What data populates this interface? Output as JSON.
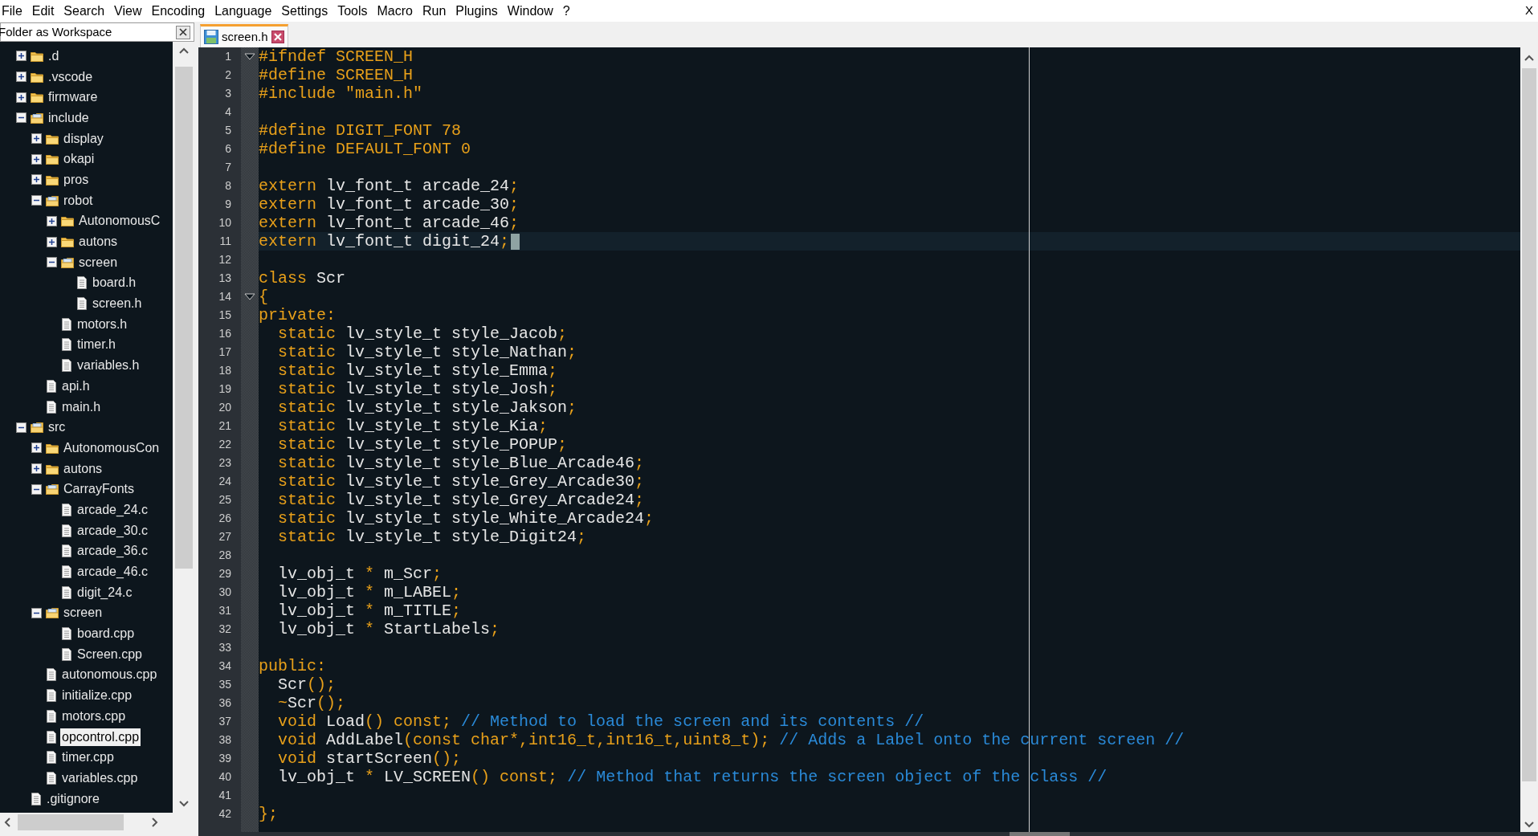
{
  "menu_bar": {
    "items": [
      "File",
      "Edit",
      "Search",
      "View",
      "Encoding",
      "Language",
      "Settings",
      "Tools",
      "Macro",
      "Run",
      "Plugins",
      "Window",
      "?"
    ],
    "close": "X"
  },
  "workspace_panel": {
    "title": "Folder as Workspace",
    "tree": [
      {
        "label": ".d",
        "kind": "folder",
        "expanded": false,
        "selected": false
      },
      {
        "label": ".vscode",
        "kind": "folder",
        "expanded": false,
        "selected": false
      },
      {
        "label": "firmware",
        "kind": "folder",
        "expanded": false,
        "selected": false
      },
      {
        "label": "include",
        "kind": "folder",
        "expanded": true,
        "selected": false,
        "children": [
          {
            "label": "display",
            "kind": "folder",
            "expanded": false,
            "selected": false
          },
          {
            "label": "okapi",
            "kind": "folder",
            "expanded": false,
            "selected": false
          },
          {
            "label": "pros",
            "kind": "folder",
            "expanded": false,
            "selected": false
          },
          {
            "label": "robot",
            "kind": "folder",
            "expanded": true,
            "selected": false,
            "children": [
              {
                "label": "AutonomousC",
                "kind": "folder",
                "expanded": false,
                "selected": false
              },
              {
                "label": "autons",
                "kind": "folder",
                "expanded": false,
                "selected": false
              },
              {
                "label": "screen",
                "kind": "folder",
                "expanded": true,
                "selected": false,
                "children": [
                  {
                    "label": "board.h",
                    "kind": "file",
                    "selected": false
                  },
                  {
                    "label": "screen.h",
                    "kind": "file",
                    "selected": false
                  }
                ]
              },
              {
                "label": "motors.h",
                "kind": "file",
                "selected": false
              },
              {
                "label": "timer.h",
                "kind": "file",
                "selected": false
              },
              {
                "label": "variables.h",
                "kind": "file",
                "selected": false
              }
            ]
          },
          {
            "label": "api.h",
            "kind": "file",
            "selected": false
          },
          {
            "label": "main.h",
            "kind": "file",
            "selected": false
          }
        ]
      },
      {
        "label": "src",
        "kind": "folder",
        "expanded": true,
        "selected": false,
        "children": [
          {
            "label": "AutonomousCon",
            "kind": "folder",
            "expanded": false,
            "selected": false
          },
          {
            "label": "autons",
            "kind": "folder",
            "expanded": false,
            "selected": false
          },
          {
            "label": "CarrayFonts",
            "kind": "folder",
            "expanded": true,
            "selected": false,
            "children": [
              {
                "label": "arcade_24.c",
                "kind": "file",
                "selected": false
              },
              {
                "label": "arcade_30.c",
                "kind": "file",
                "selected": false
              },
              {
                "label": "arcade_36.c",
                "kind": "file",
                "selected": false
              },
              {
                "label": "arcade_46.c",
                "kind": "file",
                "selected": false
              },
              {
                "label": "digit_24.c",
                "kind": "file",
                "selected": false
              }
            ]
          },
          {
            "label": "screen",
            "kind": "folder",
            "expanded": true,
            "selected": false,
            "children": [
              {
                "label": "board.cpp",
                "kind": "file",
                "selected": false
              },
              {
                "label": "Screen.cpp",
                "kind": "file",
                "selected": false
              }
            ]
          },
          {
            "label": "autonomous.cpp",
            "kind": "file",
            "selected": false
          },
          {
            "label": "initialize.cpp",
            "kind": "file",
            "selected": false
          },
          {
            "label": "motors.cpp",
            "kind": "file",
            "selected": false
          },
          {
            "label": "opcontrol.cpp",
            "kind": "file",
            "selected": true
          },
          {
            "label": "timer.cpp",
            "kind": "file",
            "selected": false
          },
          {
            "label": "variables.cpp",
            "kind": "file",
            "selected": false
          }
        ]
      },
      {
        "label": ".gitignore",
        "kind": "file",
        "selected": false
      }
    ]
  },
  "tabs": [
    {
      "label": "screen.h",
      "selected": true
    }
  ],
  "editor": {
    "lines": [
      {
        "number": "1",
        "fold": true,
        "tokens": [
          {
            "kind": "preprocessor",
            "text": "#ifndef SCREEN_H"
          }
        ]
      },
      {
        "number": "2",
        "tokens": [
          {
            "kind": "preprocessor",
            "text": "#define SCREEN_H"
          }
        ]
      },
      {
        "number": "3",
        "tokens": [
          {
            "kind": "preprocessor",
            "text": "#include \"main.h\""
          }
        ]
      },
      {
        "number": "4"
      },
      {
        "number": "5",
        "tokens": [
          {
            "kind": "preprocessor",
            "text": "#define DIGIT_FONT 78"
          }
        ]
      },
      {
        "number": "6",
        "tokens": [
          {
            "kind": "preprocessor",
            "text": "#define DEFAULT_FONT 0"
          }
        ]
      },
      {
        "number": "7"
      },
      {
        "number": "8",
        "tokens": [
          {
            "kind": "keyword",
            "text": "extern"
          },
          {
            "kind": "plain",
            "text": " lv_font_t arcade_24"
          },
          {
            "kind": "operator",
            "text": ";"
          }
        ]
      },
      {
        "number": "9",
        "tokens": [
          {
            "kind": "keyword",
            "text": "extern"
          },
          {
            "kind": "plain",
            "text": " lv_font_t arcade_30"
          },
          {
            "kind": "operator",
            "text": ";"
          }
        ]
      },
      {
        "number": "10",
        "tokens": [
          {
            "kind": "keyword",
            "text": "extern"
          },
          {
            "kind": "plain",
            "text": " lv_font_t arcade_46"
          },
          {
            "kind": "operator",
            "text": ";"
          }
        ]
      },
      {
        "number": "11",
        "current": true,
        "tokens": [
          {
            "kind": "keyword",
            "text": "extern"
          },
          {
            "kind": "plain",
            "text": " lv_font_t digit_24"
          },
          {
            "kind": "operator",
            "text": ";"
          }
        ]
      },
      {
        "number": "12"
      },
      {
        "number": "13",
        "tokens": [
          {
            "kind": "keyword",
            "text": "class"
          },
          {
            "kind": "plain",
            "text": " Scr"
          }
        ]
      },
      {
        "number": "14",
        "fold": true,
        "tokens": [
          {
            "kind": "operator",
            "text": "{"
          }
        ]
      },
      {
        "number": "15",
        "tokens": [
          {
            "kind": "keyword",
            "text": "private:"
          }
        ]
      },
      {
        "number": "16",
        "indented": true,
        "tokens": [
          {
            "kind": "keyword",
            "text": "static"
          },
          {
            "kind": "plain",
            "text": " lv_style_t style_Jacob"
          },
          {
            "kind": "operator",
            "text": ";"
          }
        ]
      },
      {
        "number": "17",
        "indented": true,
        "tokens": [
          {
            "kind": "keyword",
            "text": "static"
          },
          {
            "kind": "plain",
            "text": " lv_style_t style_Nathan"
          },
          {
            "kind": "operator",
            "text": ";"
          }
        ]
      },
      {
        "number": "18",
        "indented": true,
        "tokens": [
          {
            "kind": "keyword",
            "text": "static"
          },
          {
            "kind": "plain",
            "text": " lv_style_t style_Emma"
          },
          {
            "kind": "operator",
            "text": ";"
          }
        ]
      },
      {
        "number": "19",
        "indented": true,
        "tokens": [
          {
            "kind": "keyword",
            "text": "static"
          },
          {
            "kind": "plain",
            "text": " lv_style_t style_Josh"
          },
          {
            "kind": "operator",
            "text": ";"
          }
        ]
      },
      {
        "number": "20",
        "indented": true,
        "tokens": [
          {
            "kind": "keyword",
            "text": "static"
          },
          {
            "kind": "plain",
            "text": " lv_style_t style_Jakson"
          },
          {
            "kind": "operator",
            "text": ";"
          }
        ]
      },
      {
        "number": "21",
        "indented": true,
        "tokens": [
          {
            "kind": "keyword",
            "text": "static"
          },
          {
            "kind": "plain",
            "text": " lv_style_t style_Kia"
          },
          {
            "kind": "operator",
            "text": ";"
          }
        ]
      },
      {
        "number": "22",
        "indented": true,
        "tokens": [
          {
            "kind": "keyword",
            "text": "static"
          },
          {
            "kind": "plain",
            "text": " lv_style_t style_POPUP"
          },
          {
            "kind": "operator",
            "text": ";"
          }
        ]
      },
      {
        "number": "23",
        "indented": true,
        "tokens": [
          {
            "kind": "keyword",
            "text": "static"
          },
          {
            "kind": "plain",
            "text": " lv_style_t style_Blue_Arcade46"
          },
          {
            "kind": "operator",
            "text": ";"
          }
        ]
      },
      {
        "number": "24",
        "indented": true,
        "tokens": [
          {
            "kind": "keyword",
            "text": "static"
          },
          {
            "kind": "plain",
            "text": " lv_style_t style_Grey_Arcade30"
          },
          {
            "kind": "operator",
            "text": ";"
          }
        ]
      },
      {
        "number": "25",
        "indented": true,
        "tokens": [
          {
            "kind": "keyword",
            "text": "static"
          },
          {
            "kind": "plain",
            "text": " lv_style_t style_Grey_Arcade24"
          },
          {
            "kind": "operator",
            "text": ";"
          }
        ]
      },
      {
        "number": "26",
        "indented": true,
        "tokens": [
          {
            "kind": "keyword",
            "text": "static"
          },
          {
            "kind": "plain",
            "text": " lv_style_t style_White_Arcade24"
          },
          {
            "kind": "operator",
            "text": ";"
          }
        ]
      },
      {
        "number": "27",
        "indented": true,
        "tokens": [
          {
            "kind": "keyword",
            "text": "static"
          },
          {
            "kind": "plain",
            "text": " lv_style_t style_Digit24"
          },
          {
            "kind": "operator",
            "text": ";"
          }
        ]
      },
      {
        "number": "28"
      },
      {
        "number": "29",
        "indented": true,
        "tokens": [
          {
            "kind": "plain",
            "text": "lv_obj_t "
          },
          {
            "kind": "operator",
            "text": "*"
          },
          {
            "kind": "plain",
            "text": " m_Scr"
          },
          {
            "kind": "operator",
            "text": ";"
          }
        ]
      },
      {
        "number": "30",
        "indented": true,
        "tokens": [
          {
            "kind": "plain",
            "text": "lv_obj_t "
          },
          {
            "kind": "operator",
            "text": "*"
          },
          {
            "kind": "plain",
            "text": " m_LABEL"
          },
          {
            "kind": "operator",
            "text": ";"
          }
        ]
      },
      {
        "number": "31",
        "indented": true,
        "tokens": [
          {
            "kind": "plain",
            "text": "lv_obj_t "
          },
          {
            "kind": "operator",
            "text": "*"
          },
          {
            "kind": "plain",
            "text": " m_TITLE"
          },
          {
            "kind": "operator",
            "text": ";"
          }
        ]
      },
      {
        "number": "32",
        "indented": true,
        "tokens": [
          {
            "kind": "plain",
            "text": "lv_obj_t "
          },
          {
            "kind": "operator",
            "text": "*"
          },
          {
            "kind": "plain",
            "text": " StartLabels"
          },
          {
            "kind": "operator",
            "text": ";"
          }
        ]
      },
      {
        "number": "33"
      },
      {
        "number": "34",
        "tokens": [
          {
            "kind": "keyword",
            "text": "public:"
          }
        ]
      },
      {
        "number": "35",
        "indented": true,
        "tokens": [
          {
            "kind": "plain",
            "text": "Scr"
          },
          {
            "kind": "operator",
            "text": "();"
          }
        ]
      },
      {
        "number": "36",
        "indented": true,
        "tokens": [
          {
            "kind": "operator",
            "text": "~"
          },
          {
            "kind": "plain",
            "text": "Scr"
          },
          {
            "kind": "operator",
            "text": "();"
          }
        ]
      },
      {
        "number": "37",
        "indented": true,
        "tokens": [
          {
            "kind": "keyword",
            "text": "void"
          },
          {
            "kind": "plain",
            "text": " Load"
          },
          {
            "kind": "operator",
            "text": "()"
          },
          {
            "kind": "keyword",
            "text": " const"
          },
          {
            "kind": "operator",
            "text": ";"
          },
          {
            "kind": "comment",
            "text": " // Method to load the screen and its contents //"
          }
        ]
      },
      {
        "number": "38",
        "indented": true,
        "tokens": [
          {
            "kind": "keyword",
            "text": "void"
          },
          {
            "kind": "plain",
            "text": " AddLabel"
          },
          {
            "kind": "operator",
            "text": "("
          },
          {
            "kind": "keyword",
            "text": "const char"
          },
          {
            "kind": "operator",
            "text": "*,"
          },
          {
            "kind": "keyword",
            "text": "int16_t"
          },
          {
            "kind": "operator",
            "text": ","
          },
          {
            "kind": "keyword",
            "text": "int16_t"
          },
          {
            "kind": "operator",
            "text": ","
          },
          {
            "kind": "keyword",
            "text": "uint8_t"
          },
          {
            "kind": "operator",
            "text": ");"
          },
          {
            "kind": "comment",
            "text": " // Adds a Label onto the current screen //"
          }
        ]
      },
      {
        "number": "39",
        "indented": true,
        "tokens": [
          {
            "kind": "keyword",
            "text": "void"
          },
          {
            "kind": "plain",
            "text": " startScreen"
          },
          {
            "kind": "operator",
            "text": "();"
          }
        ]
      },
      {
        "number": "40",
        "indented": true,
        "tokens": [
          {
            "kind": "plain",
            "text": "lv_obj_t "
          },
          {
            "kind": "operator",
            "text": "*"
          },
          {
            "kind": "plain",
            "text": " LV_SCREEN"
          },
          {
            "kind": "operator",
            "text": "()"
          },
          {
            "kind": "keyword",
            "text": " const"
          },
          {
            "kind": "operator",
            "text": ";"
          },
          {
            "kind": "comment",
            "text": " // Method that returns the screen object of the class //"
          }
        ]
      },
      {
        "number": "41"
      },
      {
        "number": "42",
        "tokens": [
          {
            "kind": "operator",
            "text": "};"
          }
        ]
      }
    ]
  }
}
